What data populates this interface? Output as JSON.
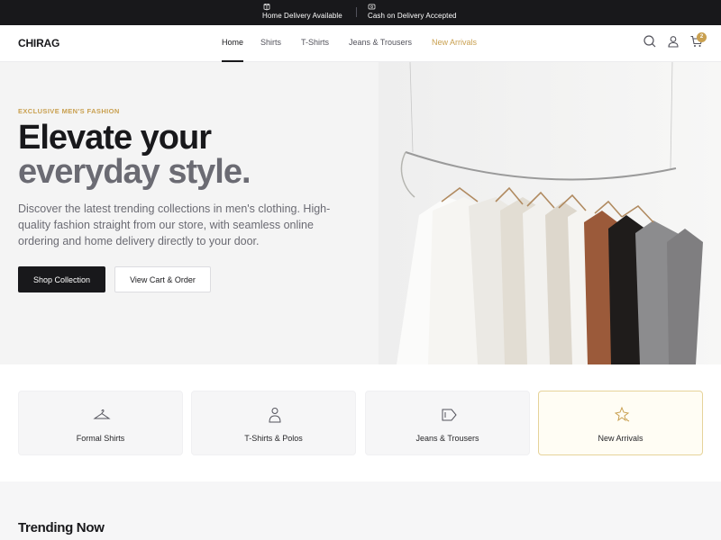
{
  "topbar": {
    "items": [
      {
        "label": "Home Delivery Available",
        "icon": "box-icon"
      },
      {
        "label": "Cash on Delivery Accepted",
        "icon": "cash-icon"
      }
    ]
  },
  "header": {
    "logo": "CHIRAG",
    "nav": [
      {
        "label": "Home",
        "active": true
      },
      {
        "label": "Shirts"
      },
      {
        "label": "T-Shirts"
      },
      {
        "label": "Jeans & Trousers"
      },
      {
        "label": "New Arrivals",
        "accent": true
      }
    ],
    "icons": [
      "search-icon",
      "user-icon",
      "cart-icon"
    ],
    "cart_count": "2"
  },
  "hero": {
    "eyebrow": "EXCLUSIVE MEN'S FASHION",
    "title_line1": "Elevate your",
    "title_line2": "everyday style.",
    "description": "Discover the latest trending collections in men's clothing. High-quality fashion straight from our store, with seamless online ordering and home delivery directly to your door.",
    "primary_button": "Shop Collection",
    "secondary_button": "View Cart & Order"
  },
  "categories": [
    {
      "label": "Formal Shirts",
      "icon": "hanger-icon"
    },
    {
      "label": "T-Shirts & Polos",
      "icon": "person-icon"
    },
    {
      "label": "Jeans & Trousers",
      "icon": "tag-icon"
    },
    {
      "label": "New Arrivals",
      "icon": "sparkle-icon",
      "highlighted": true
    }
  ],
  "trending": {
    "title": "Trending Now"
  },
  "colors": {
    "accent": "#c9a050",
    "dark": "#18181b",
    "muted": "#6b6b73"
  }
}
